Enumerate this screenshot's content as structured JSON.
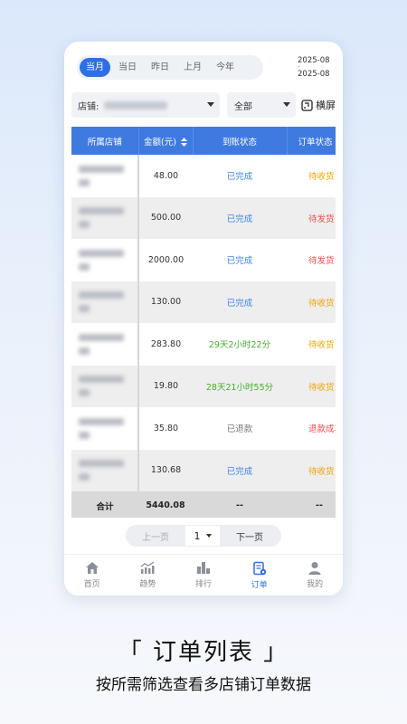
{
  "date_tabs": [
    {
      "label": "当月",
      "active": true
    },
    {
      "label": "当日",
      "active": false
    },
    {
      "label": "昨日",
      "active": false
    },
    {
      "label": "上月",
      "active": false
    },
    {
      "label": "今年",
      "active": false
    }
  ],
  "date_range": {
    "start": "2025-08",
    "separator": "-",
    "end": "2025-08"
  },
  "filters": {
    "store_label": "店铺:",
    "status_value": "全部",
    "landscape_label": "横屏"
  },
  "table": {
    "headers": [
      "所属店铺",
      "金额(元)",
      "到账状态",
      "订单状态"
    ],
    "rows": [
      {
        "amount": "48.00",
        "settle": "已完成",
        "settle_color": "blue",
        "order": "待收货",
        "order_color": "orange"
      },
      {
        "amount": "500.00",
        "settle": "已完成",
        "settle_color": "blue",
        "order": "待发货",
        "order_color": "red"
      },
      {
        "amount": "2000.00",
        "settle": "已完成",
        "settle_color": "blue",
        "order": "待发货",
        "order_color": "red"
      },
      {
        "amount": "130.00",
        "settle": "已完成",
        "settle_color": "blue",
        "order": "待收货",
        "order_color": "orange"
      },
      {
        "amount": "283.80",
        "settle": "29天2小时22分",
        "settle_color": "green",
        "order": "待收货",
        "order_color": "orange"
      },
      {
        "amount": "19.80",
        "settle": "28天21小时55分",
        "settle_color": "green",
        "order": "待收货",
        "order_color": "orange"
      },
      {
        "amount": "35.80",
        "settle": "已退款",
        "settle_color": "gray",
        "order": "退款成功",
        "order_color": "red"
      },
      {
        "amount": "130.68",
        "settle": "已完成",
        "settle_color": "blue",
        "order": "待收货",
        "order_color": "orange"
      }
    ],
    "total": {
      "label": "合计",
      "amount": "5440.08",
      "settle": "--",
      "order": "--"
    }
  },
  "pager": {
    "prev": "上一页",
    "page": "1",
    "next": "下一页"
  },
  "tabbar": [
    {
      "label": "首页",
      "icon": "home-icon",
      "active": false
    },
    {
      "label": "趋势",
      "icon": "trend-icon",
      "active": false
    },
    {
      "label": "排行",
      "icon": "ranking-icon",
      "active": false
    },
    {
      "label": "订单",
      "icon": "order-icon",
      "active": true
    },
    {
      "label": "我的",
      "icon": "profile-icon",
      "active": false
    }
  ],
  "caption": {
    "title": "「 订单列表 」",
    "subtitle": "按所需筛选查看多店铺订单数据"
  },
  "colors": {
    "accent": "#2f6fe6",
    "header_bg": "#3f7ae0",
    "blue_text": "#3b85e6",
    "green_text": "#42b02a",
    "orange_text": "#f2a300",
    "red_text": "#ee4d4d"
  }
}
